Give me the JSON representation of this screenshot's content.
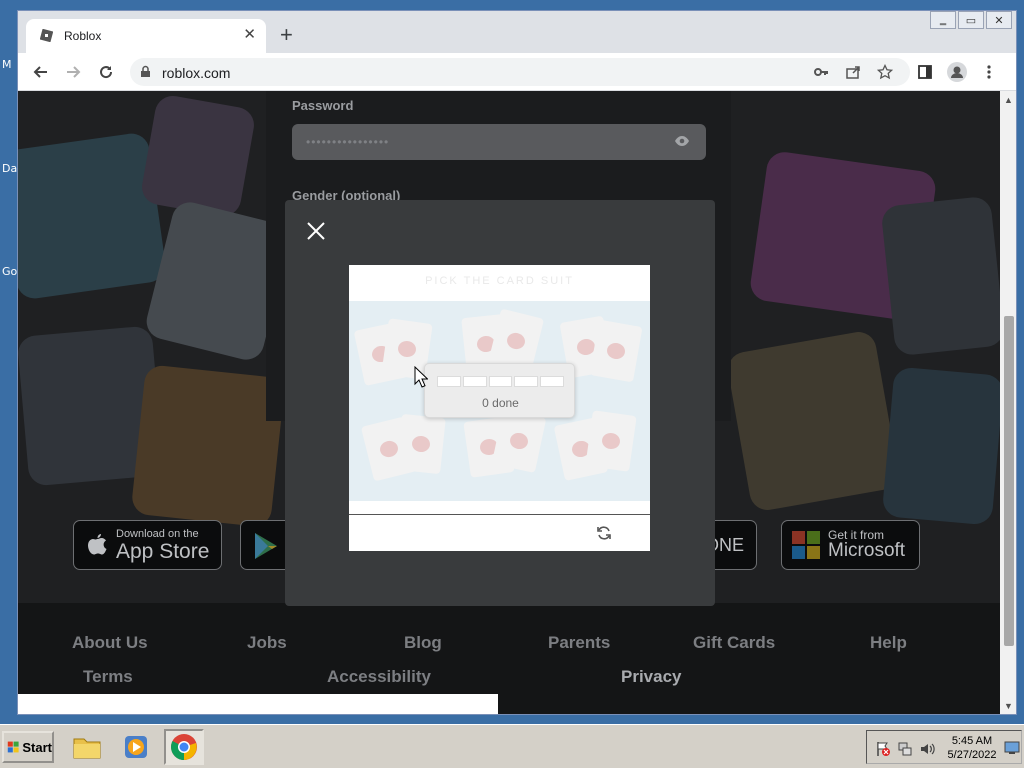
{
  "desktop": {
    "labels": [
      "M",
      "Da",
      "Go"
    ]
  },
  "browser": {
    "tab_title": "Roblox",
    "tab_close": "✕",
    "new_tab": "+",
    "url": "roblox.com",
    "window_controls": [
      "‗",
      "▭",
      "✕"
    ]
  },
  "page": {
    "password_label": "Password",
    "password_mask": "••••••••••••••••",
    "gender_label": "Gender (optional)",
    "badges": [
      {
        "small": "Download on the",
        "big": "App Store"
      },
      {
        "small": "",
        "big": "ONE"
      },
      {
        "small": "Get it from",
        "big": "Microsoft"
      }
    ],
    "footer_links": [
      "About Us",
      "Jobs",
      "Blog",
      "Parents",
      "Gift Cards",
      "Help"
    ],
    "footer_links_row2": [
      "Terms",
      "Accessibility",
      "Privacy"
    ]
  },
  "captcha": {
    "header_text": "PICK THE CARD SUIT",
    "progress_text": "0 done",
    "progress_done": 0,
    "progress_total": 5
  },
  "taskbar": {
    "start_label": "Start",
    "time": "5:45 AM",
    "date": "5/27/2022"
  },
  "colors": {
    "page_bg": "#1f2022",
    "modal_bg": "#393b3d",
    "taskbar": "#d4d0c8",
    "desktop": "#3a6ea5"
  }
}
